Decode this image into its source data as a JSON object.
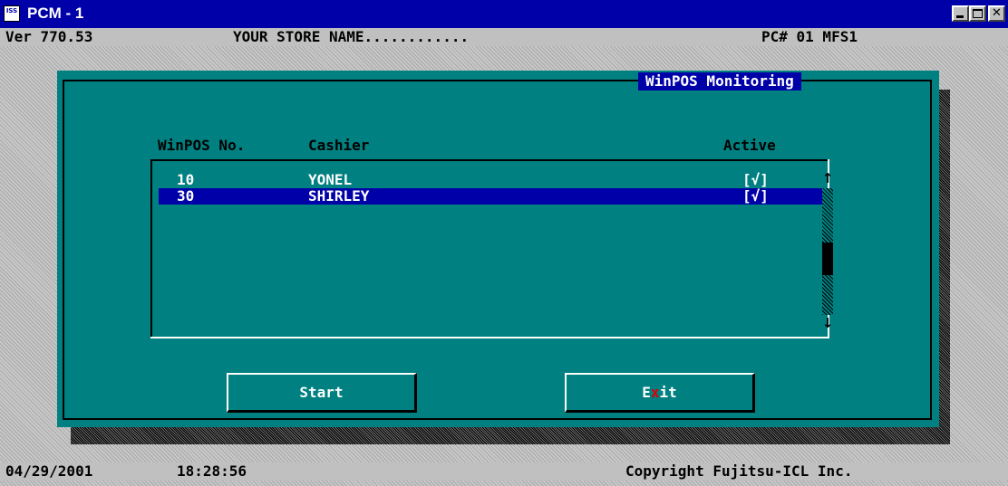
{
  "window": {
    "title": "PCM - 1",
    "icon_text": "ISS"
  },
  "header": {
    "version": "Ver 770.53",
    "store_name": "YOUR STORE NAME............",
    "pc_id": "PC# 01 MFS1"
  },
  "dialog": {
    "title": "WinPOS Monitoring",
    "columns": {
      "number": "WinPOS No.",
      "cashier": "Cashier",
      "active": "Active"
    },
    "rows": [
      {
        "number": "10",
        "cashier": "YONEL",
        "active": "[√]"
      },
      {
        "number": "30",
        "cashier": "SHIRLEY",
        "active": "[√]"
      }
    ],
    "selected_row": 1,
    "scrollbar": {
      "up_arrow": "↑",
      "down_arrow": "↓"
    },
    "buttons": {
      "start": "Start",
      "exit_hotkey": "x",
      "exit_prefix": "E",
      "exit_suffix": "it"
    }
  },
  "footer": {
    "date": "04/29/2001",
    "time": "18:28:56",
    "copyright": "Copyright Fujitsu-ICL Inc."
  },
  "colors": {
    "title_bar": "#0000a8",
    "dialog_bg": "#008080",
    "selection": "#0000a8",
    "hotkey": "#e00000"
  }
}
